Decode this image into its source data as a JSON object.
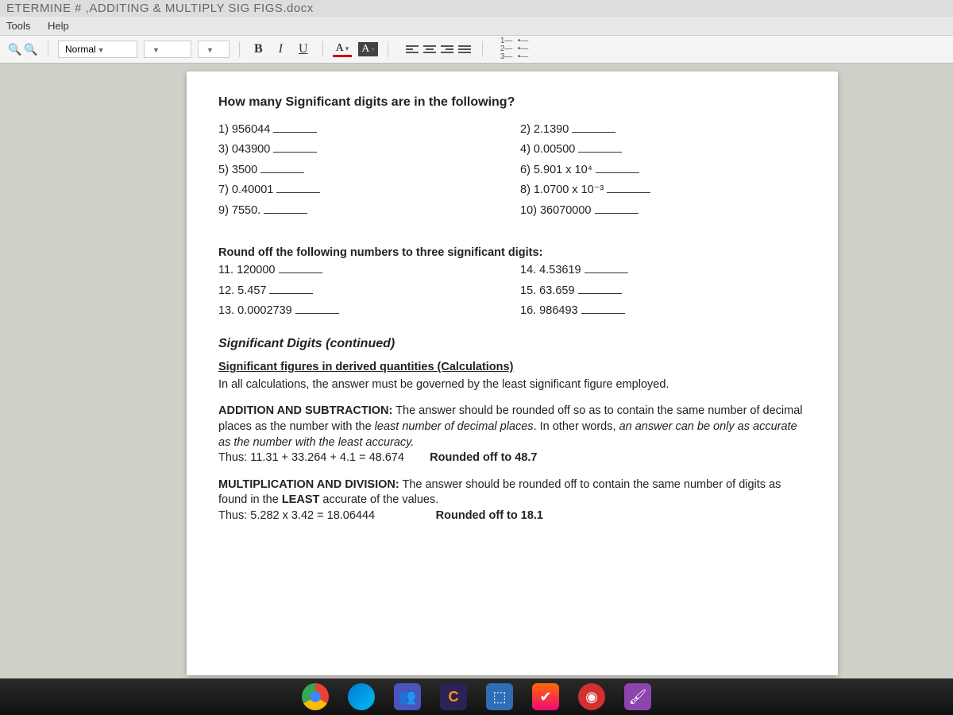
{
  "window": {
    "title": "ETERMINE # ,ADDITING & MULTIPLY SIG FIGS.docx"
  },
  "menu": {
    "tools": "Tools",
    "help": "Help"
  },
  "toolbar": {
    "style": "Normal",
    "bold": "B",
    "italic": "I",
    "underline": "U",
    "textcolor": "A",
    "highlight": "A"
  },
  "doc": {
    "heading1": "How many Significant digits are in the following?",
    "q": [
      "1) 956044",
      "2) 2.1390",
      "3) 043900",
      "4) 0.00500",
      "5) 3500",
      "6) 5.901 x 10⁴",
      "7) 0.40001",
      "8) 1.0700 x 10⁻³",
      "9) 7550.",
      "10) 36070000"
    ],
    "round_head": "Round off the following numbers to three significant digits:",
    "r": [
      "11.   120000",
      "14.   4.53619",
      "12.   5.457",
      "15.   63.659",
      "13. 0.0002739",
      "16.   986493"
    ],
    "cont": "Significant Digits (continued)",
    "calc_head": "Significant figures in derived quantities (Calculations)",
    "calc_line": "In all calculations, the answer must be governed by the least significant figure employed.",
    "add_label": "ADDITION AND SUBTRACTION:",
    "add_text1": "  The answer should be rounded off so as to contain the same number of decimal places as the number with the ",
    "add_least": "least number of decimal places",
    "add_text2": ".  In other words, ",
    "add_ital": "an answer can be only as accurate as the number with the least accuracy.",
    "add_ex": "Thus:  11.31  +   33.264  +   4.1   =   48.674",
    "add_round": "Rounded off to 48.7",
    "mul_label": "MULTIPLICATION AND DIVISION:",
    "mul_text": "  The answer should be rounded off to contain the same number of digits as found in the ",
    "mul_least": "LEAST",
    "mul_text2": " accurate of the values.",
    "mul_ex": "Thus:  5.282  x   3.42  =   18.06444",
    "mul_round": "Rounded off to 18.1"
  }
}
